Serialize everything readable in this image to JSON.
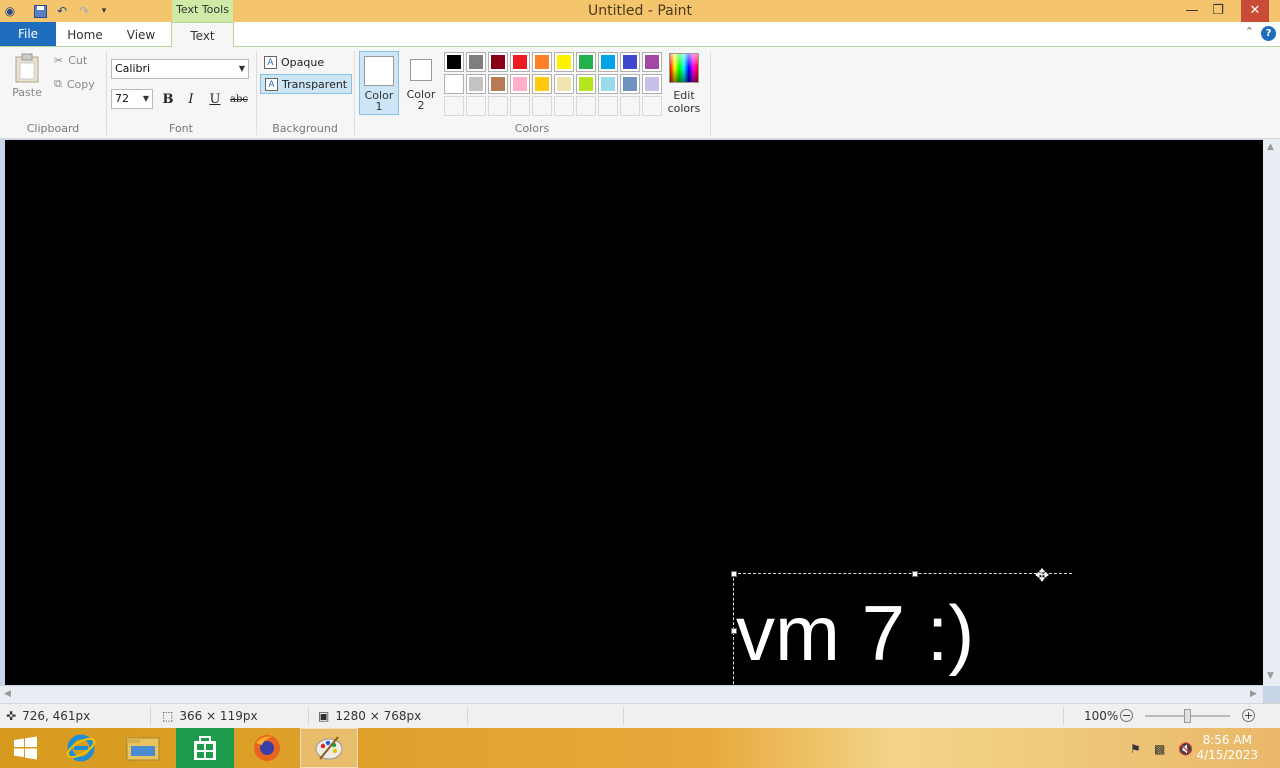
{
  "window": {
    "title": "Untitled - Paint",
    "contextual_tab_group": "Text Tools",
    "controls": {
      "minimize": "—",
      "maximize": "❐",
      "close": "✕"
    }
  },
  "tabs": {
    "file": "File",
    "items": [
      {
        "label": "Home"
      },
      {
        "label": "View"
      },
      {
        "label": "Text"
      }
    ],
    "active": "Text",
    "help": "?",
    "collapse": "⌃"
  },
  "ribbon": {
    "clipboard": {
      "group_label": "Clipboard",
      "paste": "Paste",
      "cut": "Cut",
      "copy": "Copy"
    },
    "font": {
      "group_label": "Font",
      "family": "Calibri",
      "size": "72",
      "bold": "B",
      "italic": "I",
      "underline": "U",
      "strikethrough": "abc"
    },
    "background": {
      "group_label": "Background",
      "opaque": "Opaque",
      "transparent": "Transparent",
      "selected": "Transparent"
    },
    "colors": {
      "group_label": "Colors",
      "color1": {
        "label_line1": "Color",
        "label_line2": "1",
        "value": "#ffffff"
      },
      "color2": {
        "label_line1": "Color",
        "label_line2": "2",
        "value": "#ffffff"
      },
      "palette": [
        "#000000",
        "#7f7f7f",
        "#880015",
        "#ed1c24",
        "#ff7f27",
        "#fff200",
        "#22b14c",
        "#00a2e8",
        "#3f48cc",
        "#a349a4",
        "#ffffff",
        "#c3c3c3",
        "#b97a57",
        "#ffaec9",
        "#ffc90e",
        "#efe4b0",
        "#b5e61d",
        "#99d9ea",
        "#7092be",
        "#c8bfe7"
      ],
      "empty_slots": 10,
      "edit_colors_line1": "Edit",
      "edit_colors_line2": "colors"
    }
  },
  "canvas": {
    "background": "#000000",
    "text_content": "vm 7 :)",
    "text_color": "#ffffff"
  },
  "statusbar": {
    "cursor_position": "726, 461px",
    "selection_size": "366 × 119px",
    "image_size": "1280 × 768px",
    "zoom": "100%",
    "zoom_out": "−",
    "zoom_in": "+"
  },
  "taskbar": {
    "apps": [
      {
        "name": "Internet Explorer"
      },
      {
        "name": "File Explorer"
      },
      {
        "name": "Store"
      },
      {
        "name": "Firefox"
      },
      {
        "name": "Paint",
        "active": true
      }
    ],
    "time": "8:56 AM",
    "date": "4/15/2023"
  }
}
